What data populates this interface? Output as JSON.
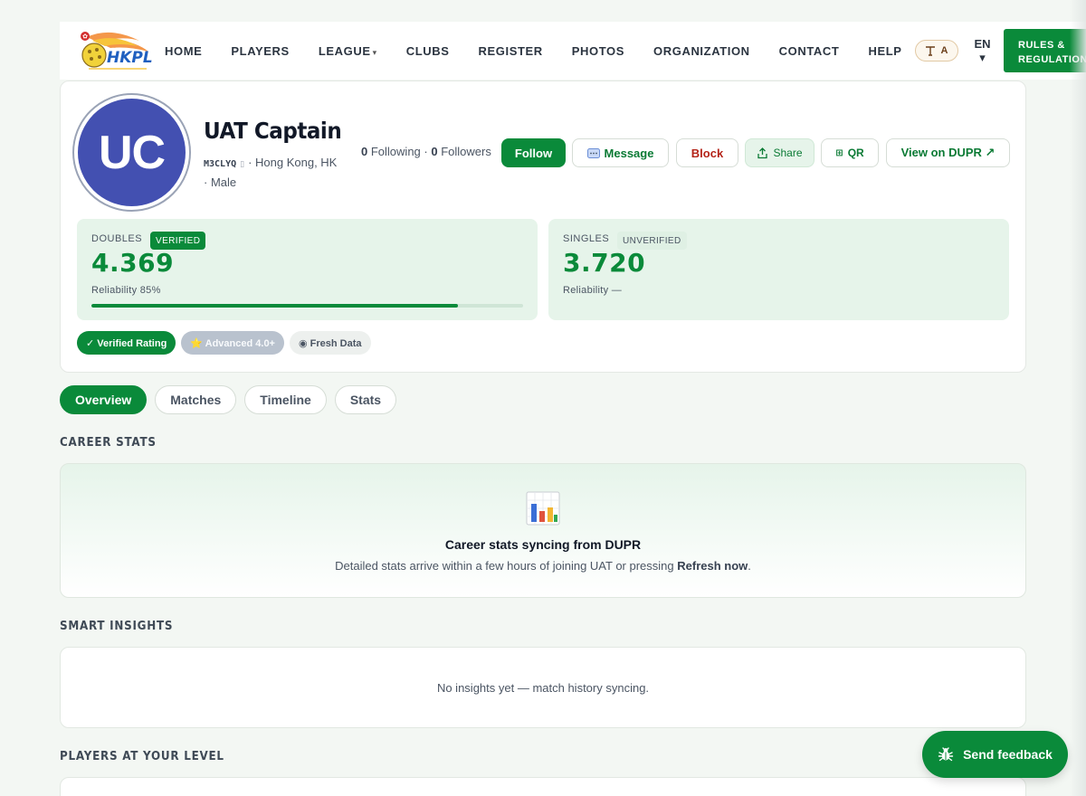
{
  "nav": {
    "logo_text": "HKPL",
    "items": [
      "HOME",
      "PLAYERS",
      "LEAGUE",
      "CLUBS",
      "REGISTER",
      "PHOTOS",
      "ORGANIZATION",
      "CONTACT",
      "HELP"
    ],
    "league_caret": "▾",
    "font_size_label": "A",
    "lang": "EN",
    "lang_caret": "▾",
    "rules_label": "RULES & REGULATIONS"
  },
  "profile": {
    "initials": "UC",
    "name": "UAT Captain",
    "code": "M3CLYQ",
    "location": "· Hong Kong, HK · Male",
    "following_count": "0",
    "following_label": "Following ·",
    "followers_count": "0",
    "followers_label": "Followers",
    "buttons": {
      "follow": "Follow",
      "message": "Message",
      "block": "Block",
      "share": "Share",
      "qr": "QR",
      "dupr": "View on DUPR ↗"
    },
    "doubles": {
      "label": "DOUBLES",
      "tag": "VERIFIED",
      "value": "4.369",
      "reliability": "Reliability 85%",
      "reliability_fraction": 0.85
    },
    "singles": {
      "label": "SINGLES",
      "tag": "UNVERIFIED",
      "value": "3.720",
      "reliability": "Reliability —"
    },
    "badges": [
      "✓ Verified Rating",
      "⭐ Advanced 4.0+",
      "◉ Fresh Data"
    ]
  },
  "tabs": [
    "Overview",
    "Matches",
    "Timeline",
    "Stats"
  ],
  "career": {
    "title": "CAREER STATS",
    "heading": "Career stats syncing from DUPR",
    "sub_before": "Detailed stats arrive within a few hours of joining UAT or pressing ",
    "sub_bold": "Refresh now",
    "sub_after": "."
  },
  "insights": {
    "title": "SMART INSIGHTS",
    "empty": "No insights yet — match history syncing."
  },
  "players": {
    "title": "PLAYERS AT YOUR LEVEL"
  },
  "feedback": {
    "label": "Send feedback"
  },
  "colors": {
    "brand_green": "#0a8a3a",
    "avatar_blue": "#4350b1",
    "block_red": "#b42318"
  }
}
